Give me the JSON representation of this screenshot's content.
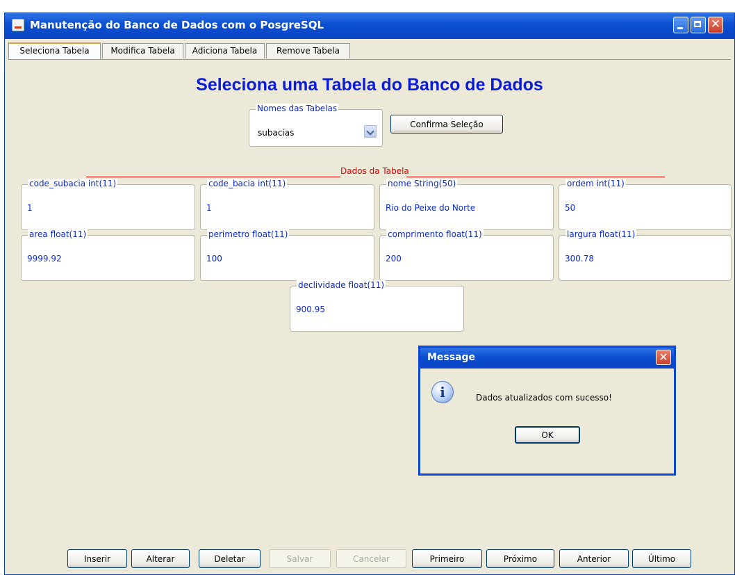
{
  "window": {
    "title": "Manutenção do Banco de Dados com o PosgreSQL",
    "close_glyph": "✕"
  },
  "tabs": [
    {
      "label": "Seleciona Tabela",
      "active": true
    },
    {
      "label": "Modifica Tabela",
      "active": false
    },
    {
      "label": "Adiciona Tabela",
      "active": false
    },
    {
      "label": "Remove Tabela",
      "active": false
    }
  ],
  "main": {
    "heading": "Seleciona uma Tabela do Banco de Dados",
    "table_selector": {
      "legend": "Nomes das Tabelas",
      "selected": "subacias"
    },
    "confirm_button": "Confirma Seleção",
    "section_label": "Dados da Tabela"
  },
  "fields": [
    {
      "label": "code_subacia int(11)",
      "value": "1"
    },
    {
      "label": "code_bacia int(11)",
      "value": "1"
    },
    {
      "label": "nome String(50)",
      "value": "Rio do Peixe do Norte"
    },
    {
      "label": "ordem int(11)",
      "value": "50"
    },
    {
      "label": "area float(11)",
      "value": "9999.92"
    },
    {
      "label": "perimetro float(11)",
      "value": "100"
    },
    {
      "label": "comprimento float(11)",
      "value": "200"
    },
    {
      "label": "largura float(11)",
      "value": "300.78"
    },
    {
      "label": "declividade float(11)",
      "value": "900.95"
    }
  ],
  "buttons": {
    "inserir": "Inserir",
    "alterar": "Alterar",
    "deletar": "Deletar",
    "salvar": "Salvar",
    "cancelar": "Cancelar",
    "primeiro": "Primeiro",
    "proximo": "Próximo",
    "anterior": "Anterior",
    "ultimo": "Último"
  },
  "dialog": {
    "title": "Message",
    "message": "Dados atualizados com sucesso!",
    "ok": "OK",
    "close_glyph": "✕",
    "info_glyph": "i"
  },
  "colors": {
    "title_bar": "#0a4ed0",
    "label_text": "#0b2ad0",
    "heading": "#0b1cd6",
    "separator": "#e00000"
  },
  "icons": [
    "java-app-icon",
    "minimize-icon",
    "maximize-icon",
    "close-icon",
    "chevron-down-icon",
    "info-icon"
  ]
}
